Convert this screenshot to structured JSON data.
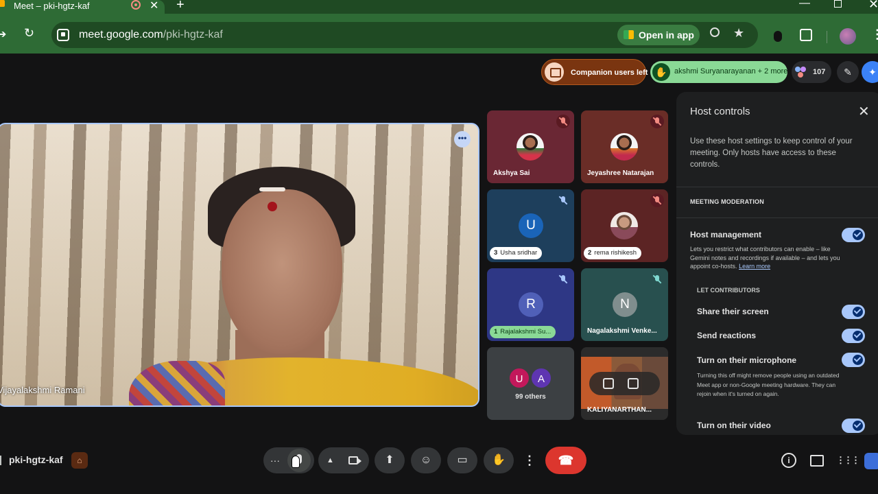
{
  "browser": {
    "tab_title": "Meet – pki-hgtz-kaf",
    "new_tab": "+",
    "url_host": "meet.google.com",
    "url_path": "/pki-hgtz-kaf",
    "open_in_app": "Open in app",
    "icons": [
      "video-site-icon",
      "search-icon",
      "star-icon",
      "extension-icon",
      "puzzle-icon",
      "profile-avatar",
      "kebab-menu-icon"
    ]
  },
  "top_pills": {
    "companion": "Companion users left",
    "hand_raised": "akshmi Suryanarayanan + 2 more",
    "people_count": "107"
  },
  "main": {
    "speaker_name": "Vijayalakshmi Ramani"
  },
  "tiles": [
    {
      "name": "Akshya Sai"
    },
    {
      "name": "Jeyashree Natarajan"
    },
    {
      "name": "Usha sridhar",
      "letter": "U",
      "hand": "3"
    },
    {
      "name": "rema rishikesh",
      "hand": "2"
    },
    {
      "name": "Rajalakshmi Su...",
      "letter": "R",
      "hand": "1"
    },
    {
      "name": "Nagalakshmi Venke...",
      "letter": "N"
    },
    {
      "others_label": "99 others",
      "letters": [
        "U",
        "A"
      ]
    },
    {
      "name": "KALIYANARTHAN..."
    }
  ],
  "panel": {
    "title": "Host controls",
    "intro": "Use these host settings to keep control of your meeting. Only hosts have access to these controls.",
    "section": "MEETING MODERATION",
    "host_management": "Host management",
    "host_management_desc": "Lets you restrict what contributors can enable – like Gemini notes and recordings if available – and lets you appoint co-hosts.",
    "learn_more": "Learn more",
    "let_contributors": "LET CONTRIBUTORS",
    "options": [
      "Share their screen",
      "Send reactions",
      "Turn on their microphone",
      "Turn on their video"
    ],
    "mic_desc": "Turning this off might remove people using an outdated Meet app or non-Google meeting hardware. They can rejoin when it's turned on again."
  },
  "bottom": {
    "meeting_code": "pki-hgtz-kaf"
  },
  "colors": {
    "chrome_green": "#2e6b35",
    "meet_bg": "#131314",
    "accent_blue": "#a8c7fa",
    "hangup_red": "#dc362e"
  }
}
